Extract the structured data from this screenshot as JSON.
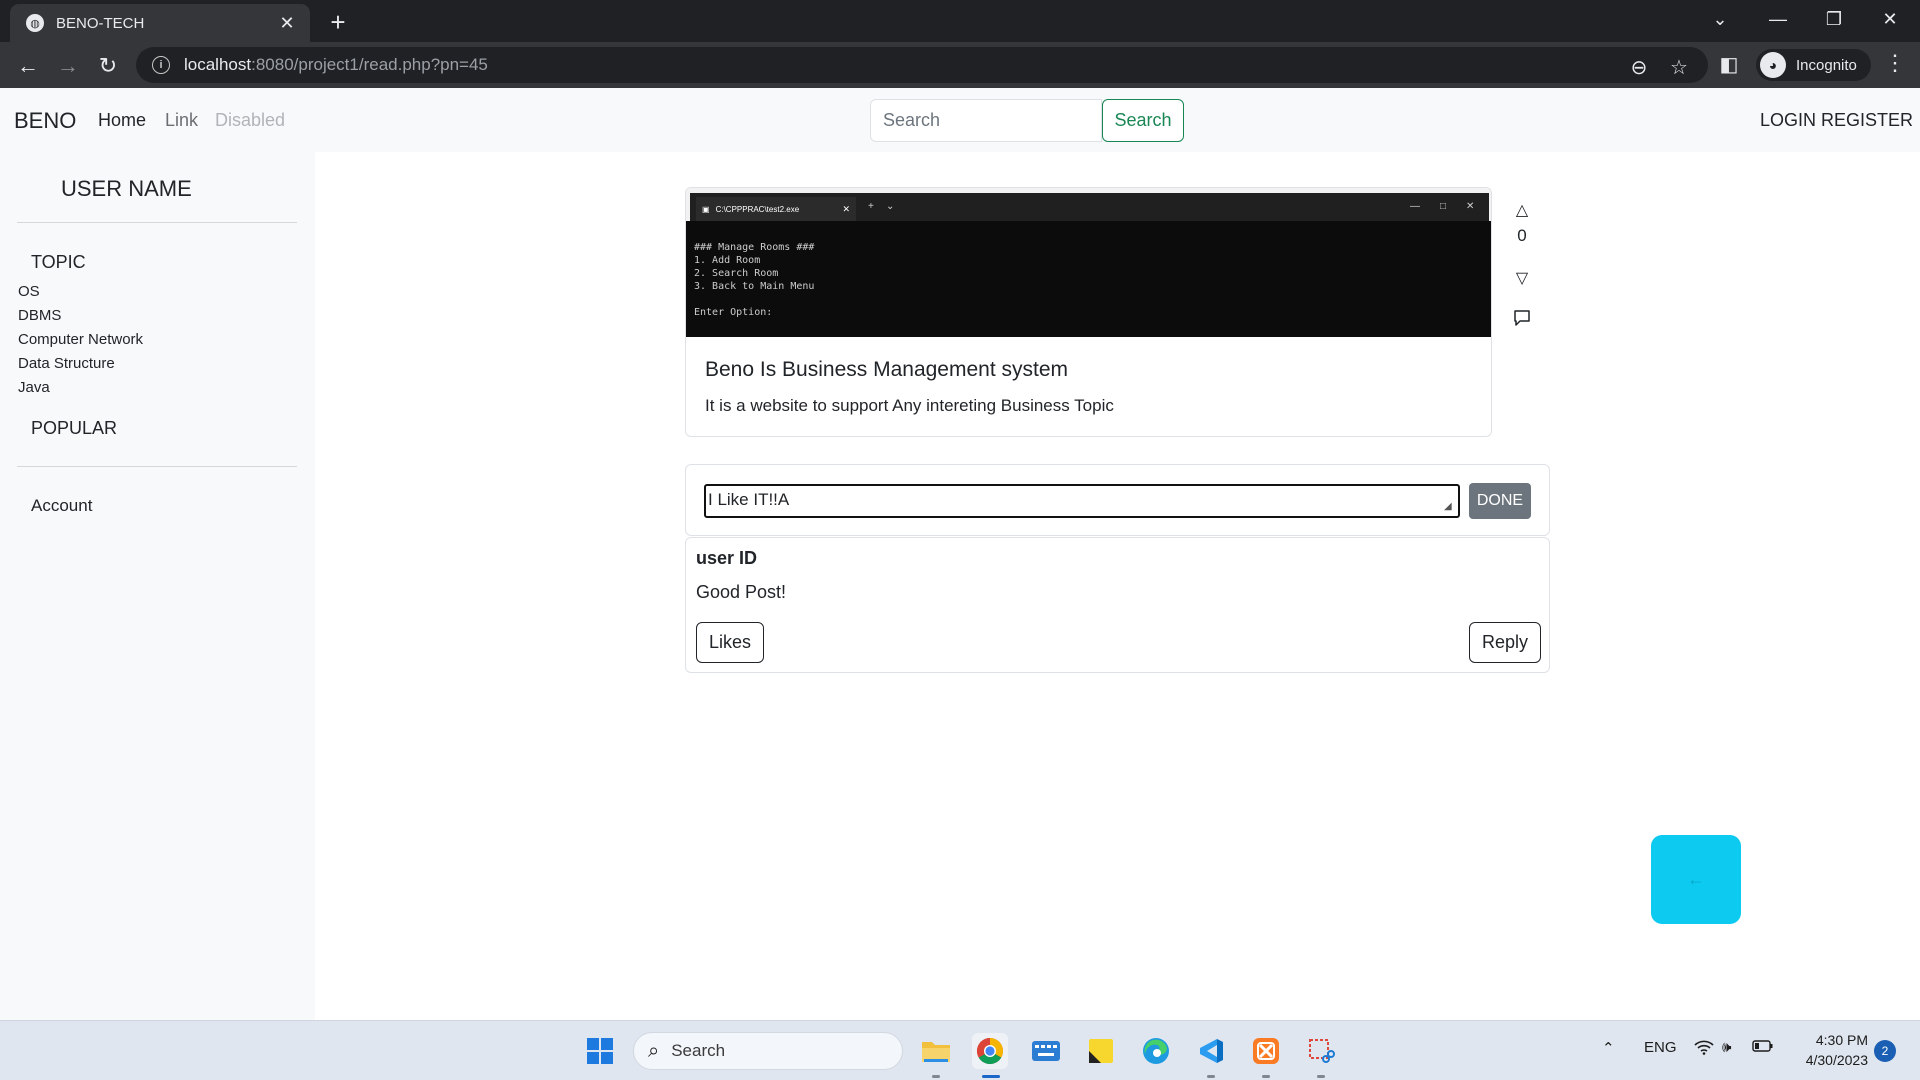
{
  "browser": {
    "tab_title": "BENO-TECH",
    "tab_close": "✕",
    "new_tab": "+",
    "url_host": "localhost",
    "url_path": ":8080/project1/read.php?pn=45",
    "profile_label": "Incognito"
  },
  "navbar": {
    "brand": "BENO",
    "links": [
      {
        "label": "Home",
        "state": "active"
      },
      {
        "label": "Link",
        "state": "normal"
      },
      {
        "label": "Disabled",
        "state": "disabled"
      }
    ],
    "search_placeholder": "Search",
    "search_button": "Search",
    "login": "LOGIN",
    "register": "REGISTER"
  },
  "sidebar": {
    "username": "USER NAME",
    "topic_heading": "TOPIC",
    "topics": [
      "OS",
      "DBMS",
      "Computer Network",
      "Data Structure",
      "Java"
    ],
    "popular_heading": "POPULAR",
    "account": "Account"
  },
  "post": {
    "title": "Beno Is Business Management system",
    "text": "It is a website to support Any intereting Business Topic",
    "image": {
      "window_tab": "C:\\CPPPRAC\\test2.exe",
      "lines": [
        "### Manage Rooms ###",
        "1. Add Room",
        "2. Search Room",
        "3. Back to Main Menu",
        "",
        "Enter Option:"
      ]
    },
    "vote_count": "0"
  },
  "comment_form": {
    "input_value": "I Like IT!!A",
    "submit_label": "DONE"
  },
  "comments": [
    {
      "user": "user ID",
      "text": "Good Post!",
      "likes_label": "Likes",
      "reply_label": "Reply"
    }
  ],
  "fab": {
    "icon": "arrow-left-icon",
    "glyph": "←"
  },
  "taskbar": {
    "search_label": "Search",
    "language": "ENG",
    "time": "4:30 PM",
    "date": "4/30/2023",
    "notification_count": "2"
  },
  "colors": {
    "success": "#198754",
    "secondary": "#6c757d",
    "info": "#0dcaf0",
    "navbar_bg": "#f8f9fa"
  }
}
